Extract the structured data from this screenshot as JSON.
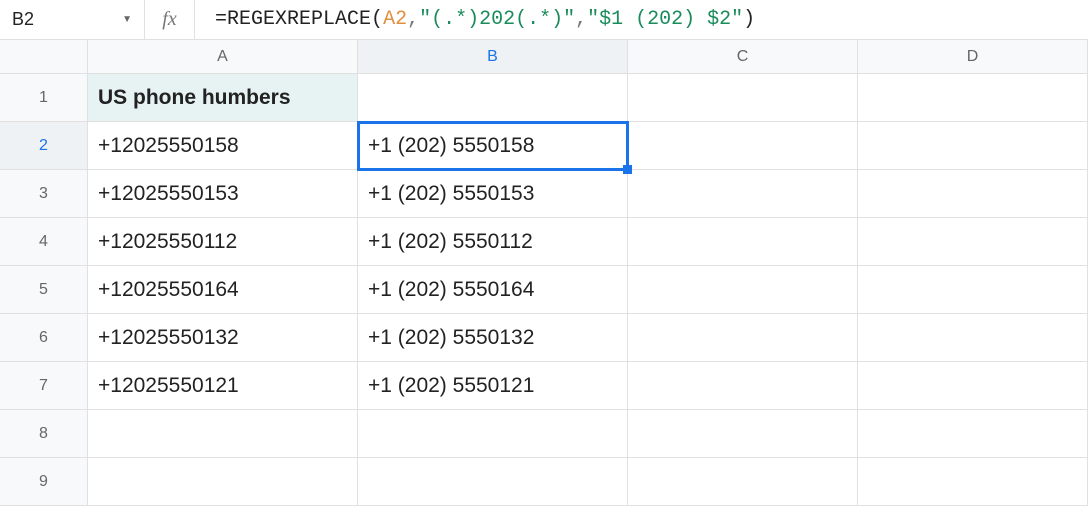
{
  "activeCell": "B2",
  "formula": {
    "prefix": "=",
    "fn": "REGEXREPLACE",
    "open": "(",
    "ref": "A2",
    "c1": ",",
    "arg2": "\"(.*)202(.*)\"",
    "c2": ",",
    "arg3": "\"$1 (202) $2\"",
    "close": ")"
  },
  "columns": [
    "A",
    "B",
    "C",
    "D"
  ],
  "rows": {
    "1": {
      "A": "US phone humbers",
      "B": "",
      "C": "",
      "D": ""
    },
    "2": {
      "A": "+12025550158",
      "B": "+1 (202) 5550158",
      "C": "",
      "D": ""
    },
    "3": {
      "A": "+12025550153",
      "B": "+1 (202) 5550153",
      "C": "",
      "D": ""
    },
    "4": {
      "A": "+12025550112",
      "B": "+1 (202) 5550112",
      "C": "",
      "D": ""
    },
    "5": {
      "A": "+12025550164",
      "B": "+1 (202) 5550164",
      "C": "",
      "D": ""
    },
    "6": {
      "A": "+12025550132",
      "B": "+1 (202) 5550132",
      "C": "",
      "D": ""
    },
    "7": {
      "A": "+12025550121",
      "B": "+1 (202) 5550121",
      "C": "",
      "D": ""
    },
    "8": {
      "A": "",
      "B": "",
      "C": "",
      "D": ""
    },
    "9": {
      "A": "",
      "B": "",
      "C": "",
      "D": ""
    }
  },
  "rowOrder": [
    "1",
    "2",
    "3",
    "4",
    "5",
    "6",
    "7",
    "8",
    "9"
  ]
}
